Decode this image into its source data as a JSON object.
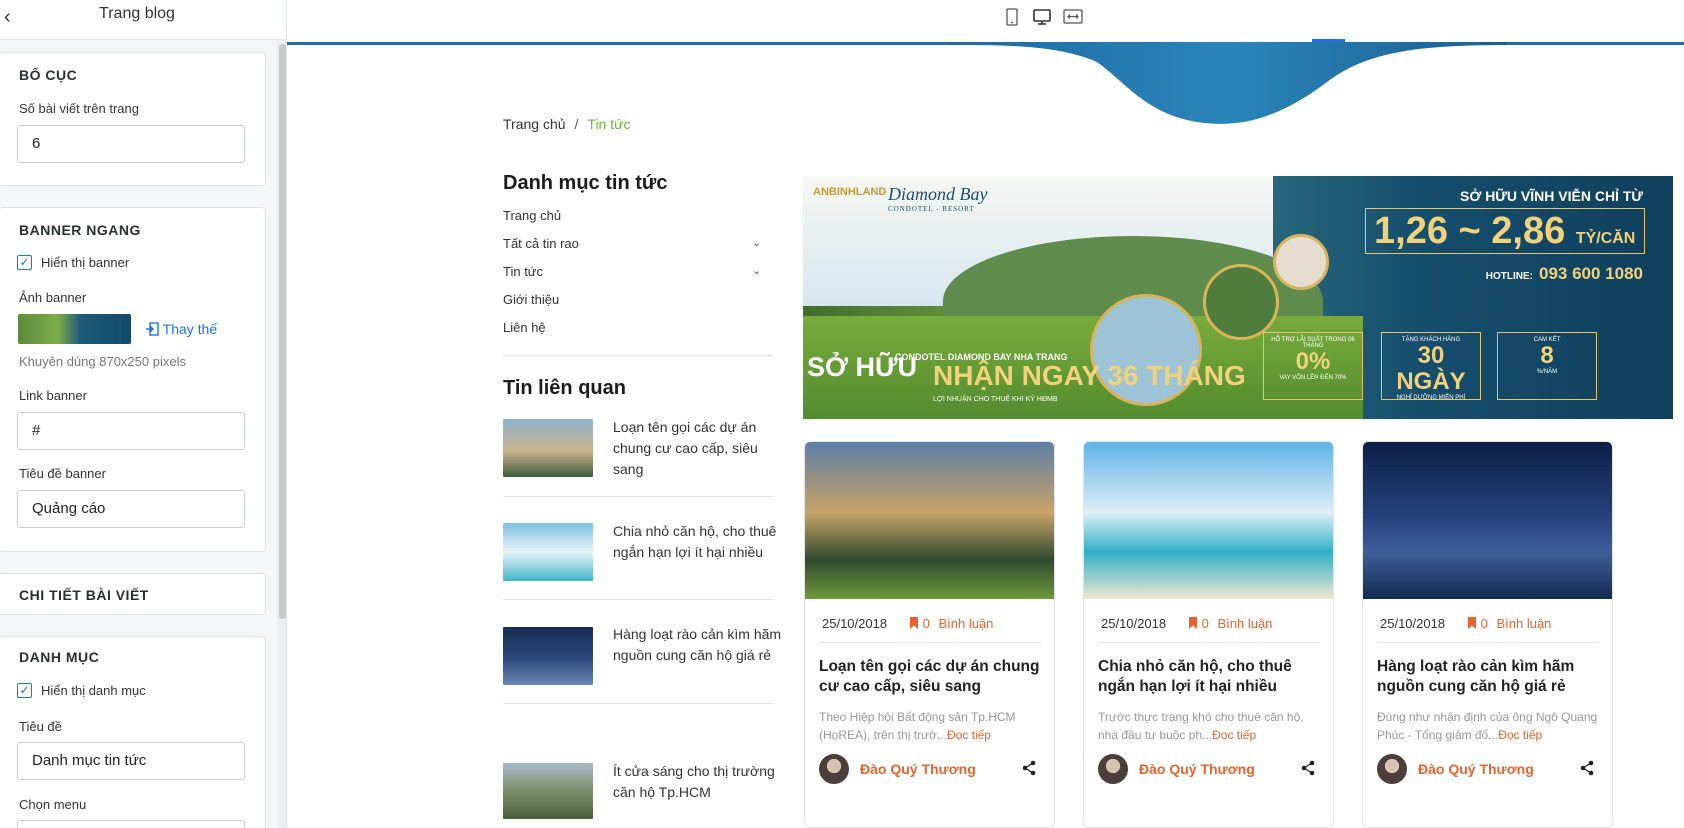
{
  "sidebar": {
    "title": "Trang blog",
    "layout": {
      "heading": "BỐ CỤC",
      "posts_per_page_label": "Số bài viết trên trang",
      "posts_per_page_value": "6"
    },
    "banner": {
      "heading": "BANNER NGANG",
      "show_label": "Hiển thị banner",
      "show_checked": true,
      "image_label": "Ảnh banner",
      "replace_label": "Thay thế",
      "hint": "Khuyên dùng 870x250 pixels",
      "link_label": "Link banner",
      "link_value": "#",
      "title_label": "Tiêu đề banner",
      "title_value": "Quảng cáo"
    },
    "post_detail": {
      "heading": "CHI TIẾT BÀI VIẾT"
    },
    "category": {
      "heading": "DANH MỤC",
      "show_label": "Hiển thị danh mục",
      "show_checked": true,
      "title_label": "Tiêu đề",
      "title_value": "Danh mục tin tức",
      "menu_label": "Chọn menu"
    }
  },
  "topbar": {
    "devices": [
      "mobile-icon",
      "desktop-icon",
      "fullwidth-icon"
    ],
    "active": "desktop-icon"
  },
  "preview": {
    "breadcrumb": {
      "home": "Trang chủ",
      "sep": "/",
      "current": "Tin tức"
    },
    "category_heading": "Danh mục tin tức",
    "menu": [
      {
        "label": "Trang chủ",
        "has_children": false
      },
      {
        "label": "Tất cả tin rao",
        "has_children": true
      },
      {
        "label": "Tin tức",
        "has_children": true
      },
      {
        "label": "Giới thiệu",
        "has_children": false
      },
      {
        "label": "Liên hệ",
        "has_children": false
      }
    ],
    "related_heading": "Tin liên quan",
    "related": [
      {
        "title": "Loạn tên gọi các dự án chung cư cao cấp, siêu sang"
      },
      {
        "title": "Chia nhỏ căn hộ, cho thuê ngắn hạn lợi ít hại nhiều"
      },
      {
        "title": "Hàng loạt rào cản kìm hãm nguồn cung căn hộ giá rẻ"
      },
      {
        "title": "Ít cửa sáng cho thị trường căn hộ Tp.HCM"
      }
    ],
    "banner_text": {
      "logo1": "ANBINHLAND",
      "logo2": "Diamond Bay",
      "logo2_sub": "CONDOTEL - RESORT",
      "headline": "SỞ HỮU VĨNH VIỄN CHỈ TỪ",
      "price": "1,26 ~ 2,86",
      "price_unit": "TỶ/CĂN",
      "hotline_label": "HOTLINE:",
      "hotline": "093 600 1080",
      "own": "SỞ HỮU",
      "own_sub": "CONDOTEL DIAMOND BAY NHA TRANG",
      "months": "NHẬN NGAY 36 THÁNG",
      "months_sub": "LỢI NHUẬN CHO THUÊ KHI KÝ HĐMB",
      "box1_top": "HỖ TRỢ LÃI SUẤT TRONG 06 THÁNG",
      "box1_big": "0%",
      "box1_bot": "VAY VỐN LÊN ĐẾN 70%",
      "box2_top": "TẶNG KHÁCH HÀNG",
      "box2_big": "30 NGÀY",
      "box2_bot": "NGHỈ DƯỠNG MIỄN PHÍ",
      "box3_top": "CAM KẾT",
      "box3_big": "8",
      "box3_bot": "%/NĂM"
    },
    "posts": [
      {
        "date": "25/10/2018",
        "comments": "0",
        "comment_label": "Bình luận",
        "title": "Loạn tên gọi các dự án chung cư cao cấp, siêu sang",
        "excerpt": "Theo Hiệp hội Bất động sản Tp.HCM (HoREA), trên thị trườ...",
        "more": "Đọc tiếp",
        "author": "Đào Quý Thương"
      },
      {
        "date": "25/10/2018",
        "comments": "0",
        "comment_label": "Bình luận",
        "title": "Chia nhỏ căn hộ, cho thuê ngắn hạn lợi ít hại nhiều",
        "excerpt": "Trước thực trạng khó cho thuê căn hộ, nhà đầu tư buộc ph...",
        "more": "Đọc tiếp",
        "author": "Đào Quý Thương"
      },
      {
        "date": "25/10/2018",
        "comments": "0",
        "comment_label": "Bình luận",
        "title": "Hàng loạt rào cản kìm hãm nguồn cung căn hộ giá rẻ",
        "excerpt": "Đúng như nhận định của ông Ngô Quang Phúc - Tổng giám đố...",
        "more": "Đọc tiếp",
        "author": "Đào Quý Thương"
      }
    ]
  }
}
